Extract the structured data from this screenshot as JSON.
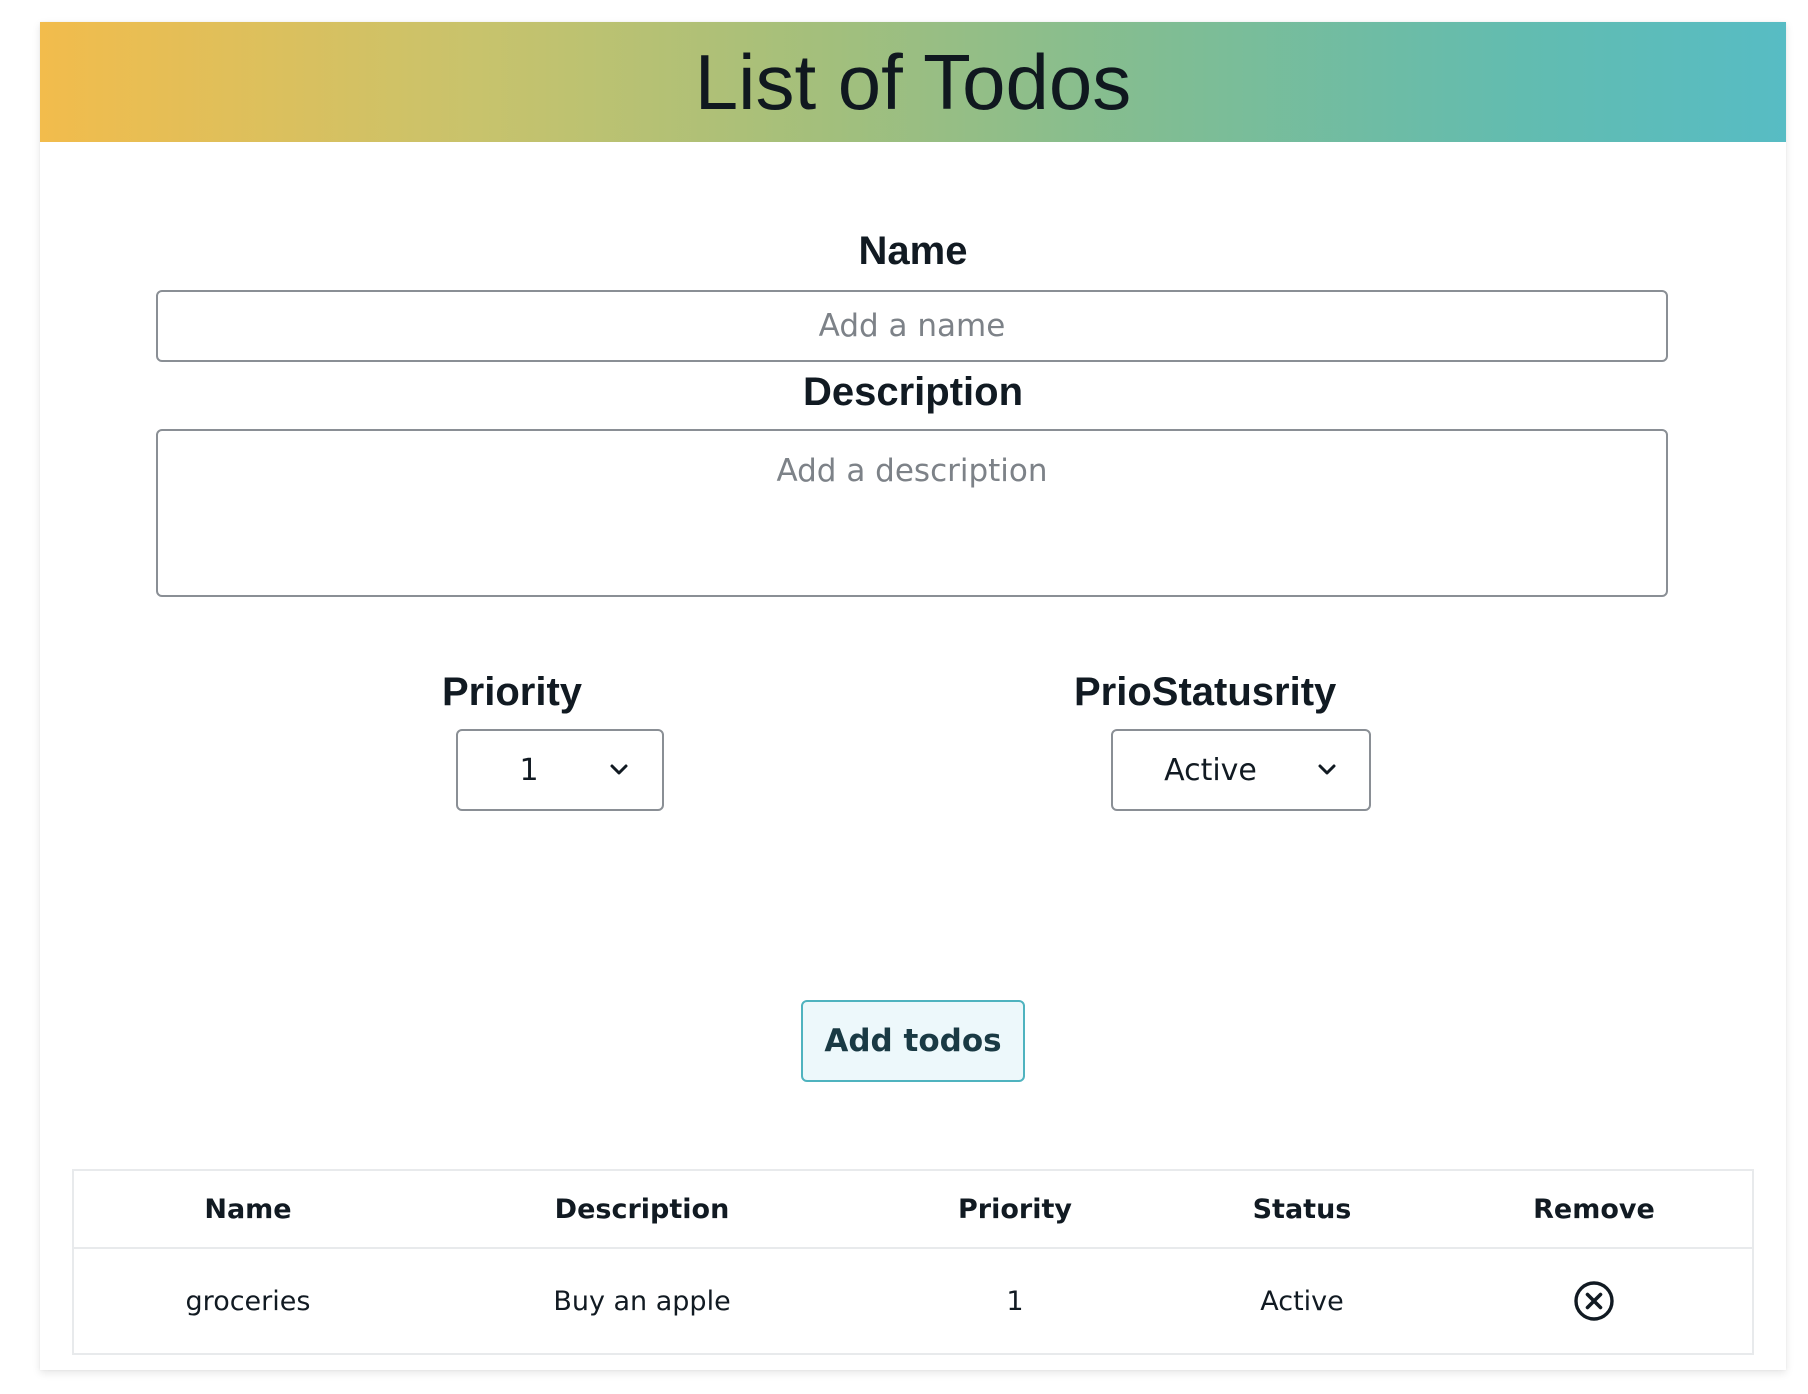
{
  "header": {
    "title": "List of Todos",
    "gradient_colors": [
      "#f2bc4c",
      "#57bcc4"
    ]
  },
  "form": {
    "name_label": "Name",
    "name_placeholder": "Add a name",
    "name_value": "",
    "description_label": "Description",
    "description_placeholder": "Add a description",
    "description_value": "",
    "priority_label": "Priority",
    "priority_value": "1",
    "status_label": "PrioStatusrity",
    "status_value": "Active",
    "submit_label": "Add todos"
  },
  "table": {
    "columns": [
      "Name",
      "Description",
      "Priority",
      "Status",
      "Remove"
    ],
    "rows": [
      {
        "name": "groceries",
        "description": "Buy an apple",
        "priority": "1",
        "status": "Active",
        "remove_icon": "close-circle-icon"
      }
    ]
  },
  "colors": {
    "button_border": "#4fb3bf",
    "button_bg": "#edf8fb",
    "input_border": "#8a8f95"
  }
}
